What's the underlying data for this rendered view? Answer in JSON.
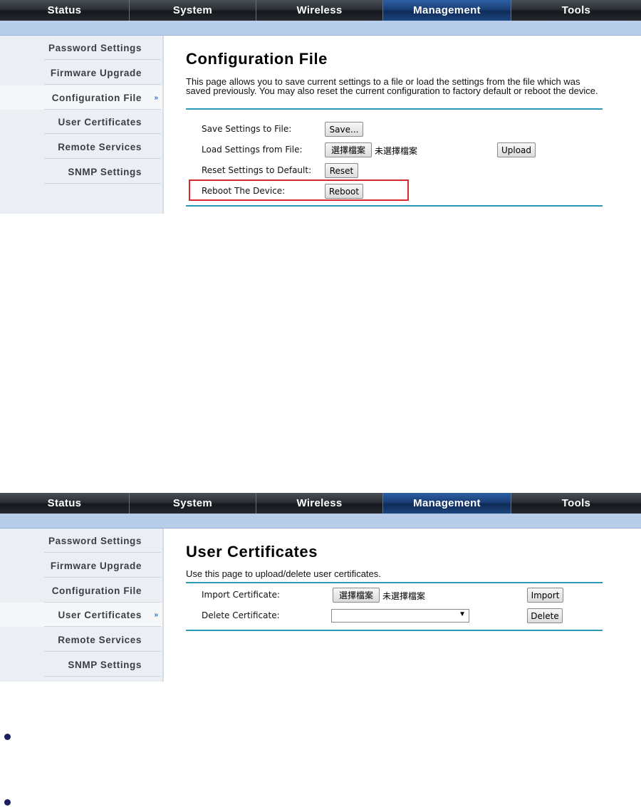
{
  "nav": {
    "tabs": [
      {
        "label": "Status"
      },
      {
        "label": "System"
      },
      {
        "label": "Wireless"
      },
      {
        "label": "Management"
      },
      {
        "label": "Tools"
      }
    ],
    "active_tab": "Management"
  },
  "sidebar": {
    "items": [
      {
        "label": "Password Settings"
      },
      {
        "label": "Firmware Upgrade"
      },
      {
        "label": "Configuration File"
      },
      {
        "label": "User Certificates"
      },
      {
        "label": "Remote Services"
      },
      {
        "label": "SNMP Settings"
      }
    ],
    "arrow": "»"
  },
  "config_page": {
    "title": "Configuration File",
    "description": "This page allows you to save current settings to a file or load the settings from the file which was saved previously. You may also reset the current configuration to factory default or reboot the device.",
    "save_label": "Save Settings to File:",
    "save_button": "Save...",
    "load_label": "Load Settings from File:",
    "choose_file_button": "選擇檔案",
    "no_file_text": "未選擇檔案",
    "upload_button": "Upload",
    "reset_label": "Reset Settings to Default:",
    "reset_button": "Reset",
    "reboot_label": "Reboot The Device:",
    "reboot_button": "Reboot"
  },
  "cert_page": {
    "title": "User Certificates",
    "description": "Use this page to upload/delete user certificates.",
    "import_label": "Import Certificate:",
    "choose_file_button": "選擇檔案",
    "no_file_text": "未選擇檔案",
    "import_button": "Import",
    "delete_label": "Delete Certificate:",
    "delete_select_value": "",
    "delete_button": "Delete"
  },
  "colors": {
    "accent_rule": "#2a9bb4",
    "highlight_box": "#d9272e",
    "nav_active": "#1a3f77"
  }
}
